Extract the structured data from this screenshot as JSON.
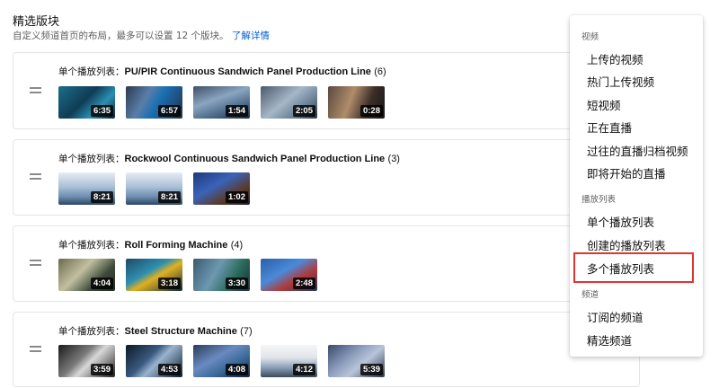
{
  "section": {
    "title": "精选版块",
    "description": "自定义频道首页的布局，最多可以设置 12 个版块。",
    "learn_more": "了解详情"
  },
  "cards": [
    {
      "prefix": "单个播放列表：",
      "name": "PU/PIR Continuous Sandwich Panel Production Line",
      "count": "(6)",
      "durations": [
        "6:35",
        "6:57",
        "1:54",
        "2:05",
        "0:28"
      ]
    },
    {
      "prefix": "单个播放列表：",
      "name": "Rockwool Continuous Sandwich Panel Production Line",
      "count": "(3)",
      "durations": [
        "8:21",
        "8:21",
        "1:02"
      ]
    },
    {
      "prefix": "单个播放列表：",
      "name": "Roll Forming Machine",
      "count": "(4)",
      "durations": [
        "4:04",
        "3:18",
        "3:30",
        "2:48"
      ]
    },
    {
      "prefix": "单个播放列表：",
      "name": "Steel Structure Machine",
      "count": "(7)",
      "durations": [
        "3:59",
        "4:53",
        "4:08",
        "4:12",
        "5:39"
      ]
    }
  ],
  "menu": {
    "groups": [
      {
        "header": "视频",
        "items": [
          "上传的视频",
          "热门上传视频",
          "短视频",
          "正在直播",
          "过往的直播归档视频",
          "即将开始的直播"
        ]
      },
      {
        "header": "播放列表",
        "items": [
          "单个播放列表",
          "创建的播放列表",
          "多个播放列表"
        ]
      },
      {
        "header": "频道",
        "items": [
          "订阅的频道",
          "精选频道"
        ]
      }
    ],
    "highlighted_item": "多个播放列表",
    "highlight_color": "#e0352e"
  },
  "colors": {
    "link": "#065fd4",
    "duration_badge": "#000000"
  },
  "icons": {
    "drag_handle": "drag-handle-icon"
  }
}
